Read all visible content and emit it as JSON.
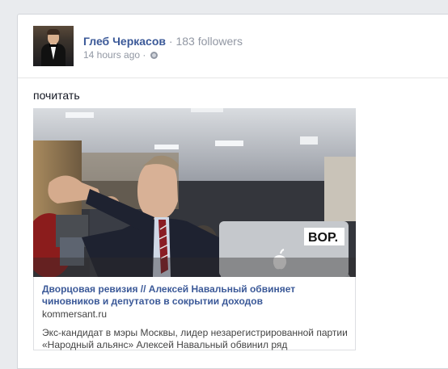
{
  "post": {
    "author": "Глеб Черкасов",
    "separator": "·",
    "followers": "183 followers",
    "time": "14 hours ago",
    "meta_separator": "·",
    "privacy_icon": "globe-icon",
    "text": "почитать"
  },
  "shared_link": {
    "title": "Дворцовая ревизия // Алексей Навальный обвиняет чиновников и депутатов в сокрытии доходов",
    "domain": "kommersant.ru",
    "description": "Экс-кандидат в мэры Москвы, лидер незарегистрированной партии «Народный альянс» Алексей Навальный обвинил ряд",
    "sticker_text": "BOP."
  },
  "colors": {
    "link": "#3b5998",
    "muted": "#9197a3",
    "background": "#e9ebee"
  }
}
